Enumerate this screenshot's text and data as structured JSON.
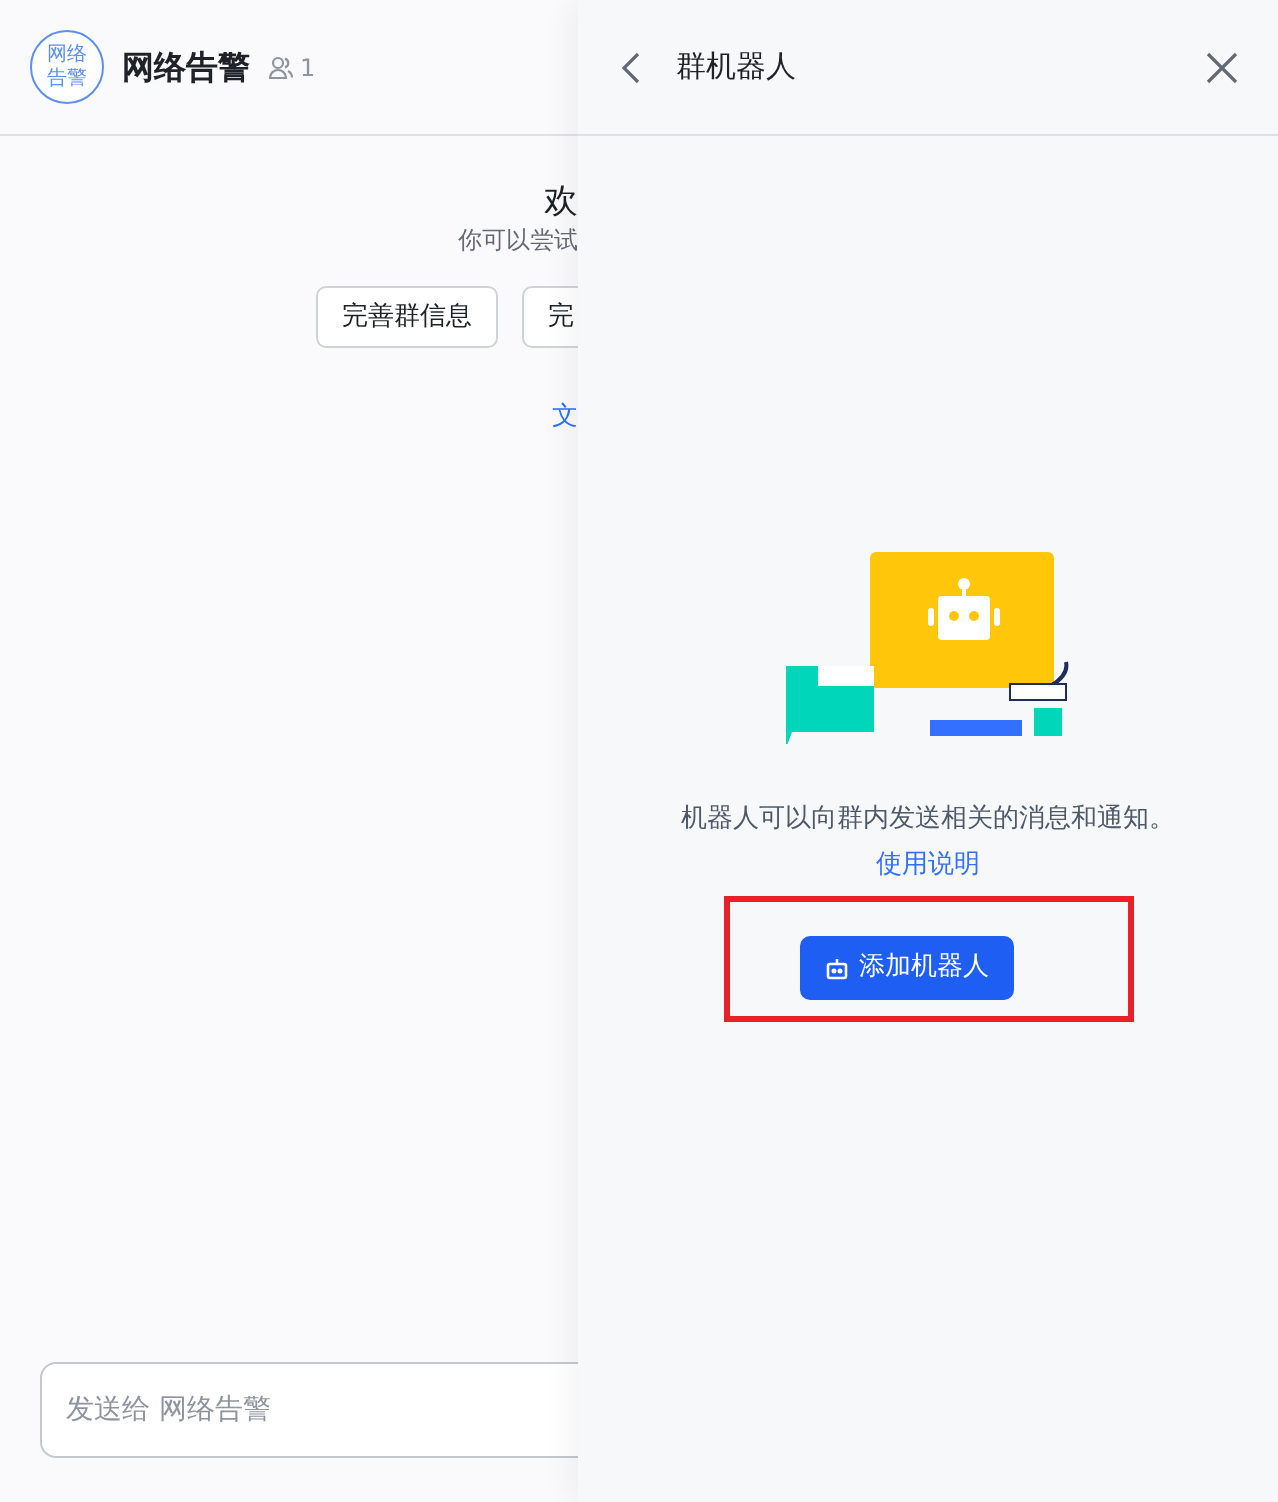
{
  "chat": {
    "avatar_text": "网络告警",
    "title": "网络告警",
    "member_count": "1",
    "welcome_title": "欢",
    "welcome_subtitle": "你可以尝试",
    "actions": [
      "完善群信息",
      "完"
    ],
    "link": "文",
    "composer": {
      "placeholder": "发送给 网络告警"
    }
  },
  "drawer": {
    "title": "群机器人",
    "description": "机器人可以向群内发送相关的消息和通知。",
    "help_link": "使用说明",
    "add_button": {
      "label": "添加机器人",
      "highlighted": true
    }
  }
}
